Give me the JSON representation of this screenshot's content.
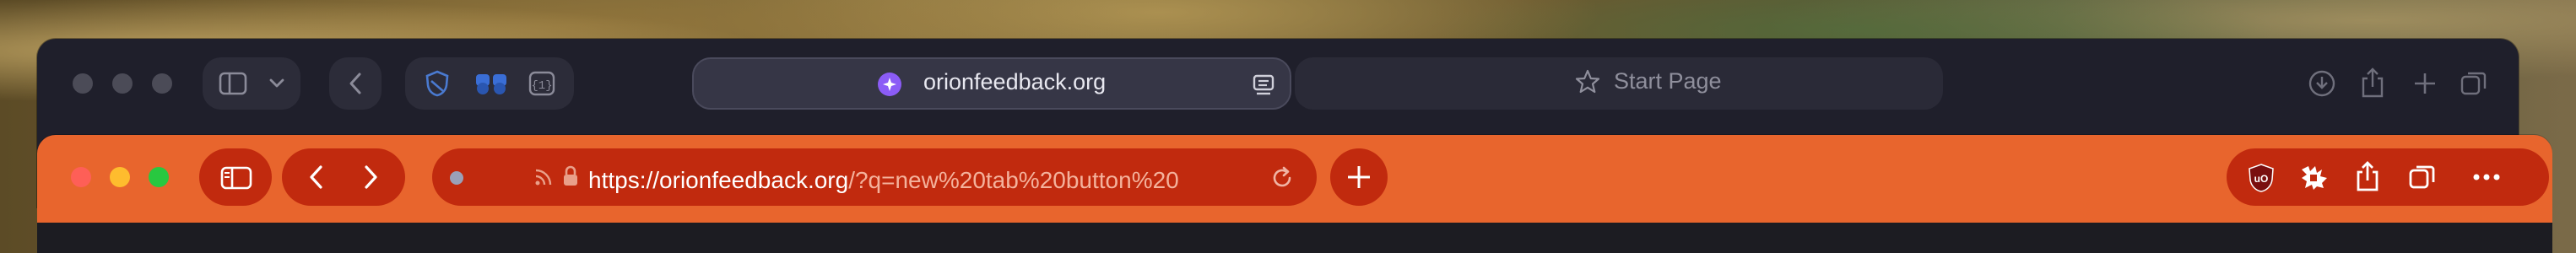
{
  "back_window": {
    "url_display": "orionfeedback.org",
    "start_page_label": "Start Page"
  },
  "front_window": {
    "url_main": "https://orionfeedback.org",
    "url_query": "/?q=new%20tab%20button%20"
  },
  "icons": {
    "sidebar": "sidebar-icon",
    "chevron": "chevron-down-icon",
    "back": "back-arrow-icon",
    "forward": "forward-arrow-icon",
    "reload": "reload-icon",
    "new_tab": "plus-icon",
    "share": "share-icon",
    "tabs": "tab-overview-icon",
    "more": "more-icon",
    "download": "download-icon"
  },
  "colors": {
    "toolbar_accent": "#e8652d",
    "toolbar_controls": "#c12a0e",
    "back_window_bg": "#1f1f2b",
    "close": "#fe5f57",
    "minimize": "#febc2e",
    "zoom": "#28c840"
  }
}
